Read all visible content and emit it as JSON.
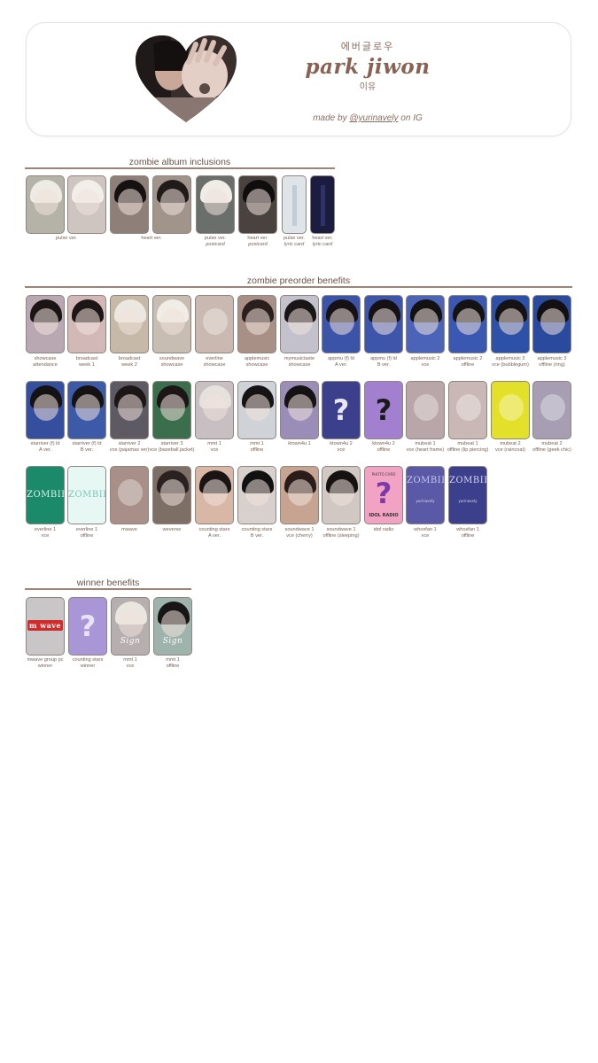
{
  "header": {
    "korean_top": "에버글로우",
    "name": "park jiwon",
    "korean_bottom": "이유",
    "credit_prefix": "made by ",
    "credit_handle": "@yurinavely",
    "credit_suffix": " on IG"
  },
  "sections": {
    "album": {
      "title": "zombie album inclusions"
    },
    "preorder": {
      "title": "zombie preorder benefits"
    },
    "winner": {
      "title": "winner benefits"
    }
  },
  "album_captions": [
    {
      "line1": "pulse ver.",
      "line2": ""
    },
    {
      "line1": "heart ver.",
      "line2": ""
    },
    {
      "line1": "pulse ver.",
      "line2": "postcard"
    },
    {
      "line1": "heart ver.",
      "line2": "postcard"
    },
    {
      "line1": "pulse ver.",
      "line2": "lyric card"
    },
    {
      "line1": "heart ver.",
      "line2": "lyric card"
    }
  ],
  "preorder_row1": [
    {
      "line1": "showcase",
      "line2": "attendance"
    },
    {
      "line1": "broadcast",
      "line2": "week 1"
    },
    {
      "line1": "broadcast",
      "line2": "week 2"
    },
    {
      "line1": "soundwave",
      "line2": "showcase"
    },
    {
      "line1": "everline",
      "line2": "showcase"
    },
    {
      "line1": "applemusic",
      "line2": "showcase"
    },
    {
      "line1": "mymusictaste",
      "line2": "showcase"
    },
    {
      "line1": "appmu (f) ld",
      "line2": "A ver."
    },
    {
      "line1": "appmu (f) ld",
      "line2": "B ver."
    },
    {
      "line1": "applemusic 2",
      "line2": "vce"
    },
    {
      "line1": "applemusic 2",
      "line2": "offline"
    },
    {
      "line1": "applemusic 3",
      "line2": "vce (bubblegum)"
    },
    {
      "line1": "applemusic 3",
      "line2": "offline (ring)"
    }
  ],
  "preorder_row2": [
    {
      "line1": "starriver (f) ld",
      "line2": "A ver."
    },
    {
      "line1": "starriver (f) ld",
      "line2": "B ver."
    },
    {
      "line1": "starriver 2",
      "line2": "vce (pajamas ver)"
    },
    {
      "line1": "starriver 3",
      "line2": "vce (baseball jacket)"
    },
    {
      "line1": "mmt 1",
      "line2": "vce"
    },
    {
      "line1": "mmt 1",
      "line2": "offline"
    },
    {
      "line1": "ktown4u 1",
      "line2": ""
    },
    {
      "line1": "ktown4u 2",
      "line2": "vce"
    },
    {
      "line1": "ktown4u 2",
      "line2": "offline"
    },
    {
      "line1": "mubeat 1",
      "line2": "vce (heart frame)"
    },
    {
      "line1": "mubeat 1",
      "line2": "offline (lip piercing)"
    },
    {
      "line1": "mubeat 2",
      "line2": "vce (raincoat)"
    },
    {
      "line1": "mubeat 2",
      "line2": "offline (geek chic)"
    }
  ],
  "preorder_row3": [
    {
      "line1": "everline 1",
      "line2": "vce"
    },
    {
      "line1": "everline 1",
      "line2": "offline"
    },
    {
      "line1": "mwave",
      "line2": ""
    },
    {
      "line1": "weverse",
      "line2": ""
    },
    {
      "line1": "counting stars",
      "line2": "A ver."
    },
    {
      "line1": "counting stars",
      "line2": "B ver."
    },
    {
      "line1": "soundwave 1",
      "line2": "vce (cherry)"
    },
    {
      "line1": "soundwave 1",
      "line2": "offline (sleeping)"
    },
    {
      "line1": "idol radio",
      "line2": ""
    },
    {
      "line1": "whosfan 1",
      "line2": "vce"
    },
    {
      "line1": "whosfan 1",
      "line2": "offline"
    }
  ],
  "winner_captions": [
    {
      "line1": "mwave group pc",
      "line2": "winner"
    },
    {
      "line1": "counting stars",
      "line2": "winner"
    },
    {
      "line1": "mmt 1",
      "line2": "vce"
    },
    {
      "line1": "mmt 1",
      "line2": "offline"
    }
  ],
  "card_text": {
    "question": "?",
    "zombie_logo": "ZOMBIE",
    "photo_card": "PHOTO CARD",
    "idol_radio": "IDOL RADIO",
    "mwave_logo": "wave",
    "sign": "Sign",
    "watermark": "yurinavely"
  },
  "colors": {
    "accent_brown": "#8a6253",
    "rule": "#a08374",
    "border": "#e6e2df"
  }
}
